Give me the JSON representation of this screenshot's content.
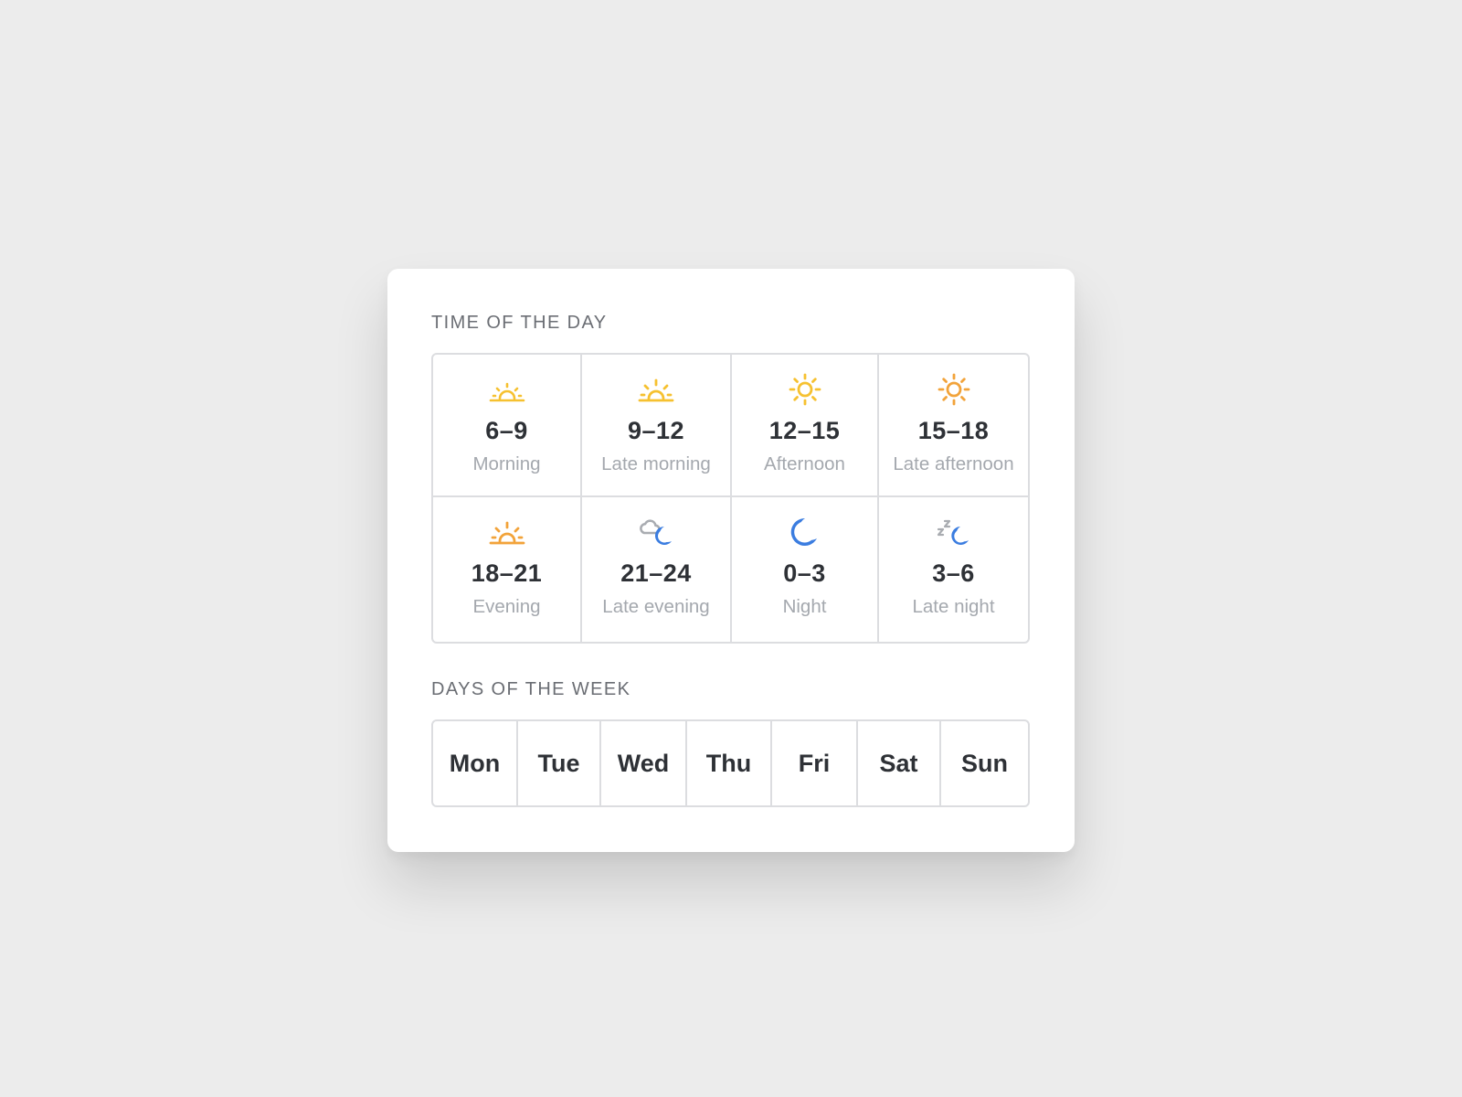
{
  "time_section": {
    "title": "TIME OF THE DAY",
    "slots": [
      {
        "range": "6–9",
        "name": "Morning",
        "icon": "sunrise-icon"
      },
      {
        "range": "9–12",
        "name": "Late morning",
        "icon": "sunrise-icon"
      },
      {
        "range": "12–15",
        "name": "Afternoon",
        "icon": "sun-icon"
      },
      {
        "range": "15–18",
        "name": "Late afternoon",
        "icon": "sun-icon"
      },
      {
        "range": "18–21",
        "name": "Evening",
        "icon": "sunset-icon"
      },
      {
        "range": "21–24",
        "name": "Late evening",
        "icon": "cloud-moon-icon"
      },
      {
        "range": "0–3",
        "name": "Night",
        "icon": "moon-icon"
      },
      {
        "range": "3–6",
        "name": "Late night",
        "icon": "sleep-moon-icon"
      }
    ]
  },
  "days_section": {
    "title": "DAYS OF THE WEEK",
    "days": [
      "Mon",
      "Tue",
      "Wed",
      "Thu",
      "Fri",
      "Sat",
      "Sun"
    ]
  },
  "colors": {
    "sun_yellow": "#f6c130",
    "sun_orange": "#f2a33a",
    "moon_blue": "#3b7de0",
    "cloud_gray": "#a9acb1"
  }
}
